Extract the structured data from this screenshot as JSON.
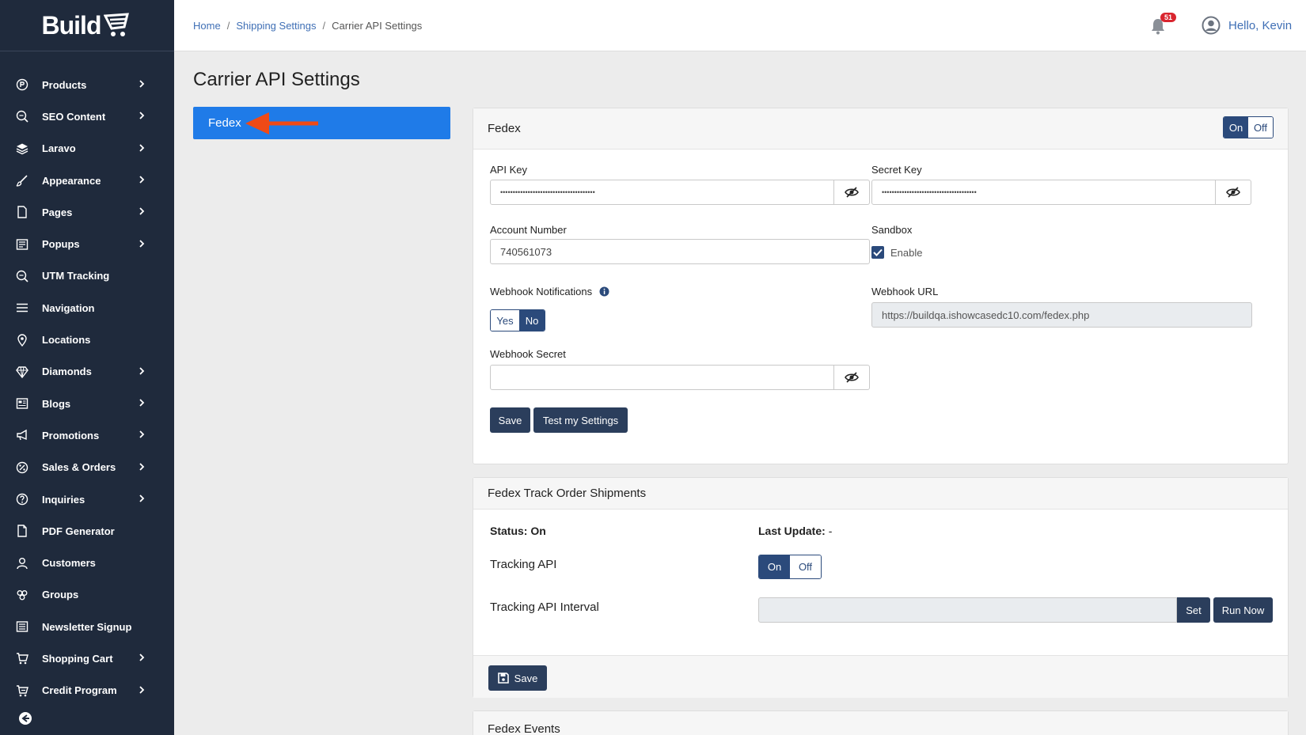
{
  "app": {
    "logo": "Build"
  },
  "sidebar": {
    "items": [
      {
        "label": "Products",
        "icon": "product-icon",
        "chevron": true
      },
      {
        "label": "SEO Content",
        "icon": "seo-icon",
        "chevron": true
      },
      {
        "label": "Laravo",
        "icon": "layers-icon",
        "chevron": true
      },
      {
        "label": "Appearance",
        "icon": "brush-icon",
        "chevron": true
      },
      {
        "label": "Pages",
        "icon": "page-icon",
        "chevron": true
      },
      {
        "label": "Popups",
        "icon": "popup-icon",
        "chevron": true
      },
      {
        "label": "UTM Tracking",
        "icon": "utm-icon",
        "chevron": false
      },
      {
        "label": "Navigation",
        "icon": "menu-icon",
        "chevron": false
      },
      {
        "label": "Locations",
        "icon": "location-pin-icon",
        "chevron": false
      },
      {
        "label": "Diamonds",
        "icon": "diamond-icon",
        "chevron": true
      },
      {
        "label": "Blogs",
        "icon": "blog-icon",
        "chevron": true
      },
      {
        "label": "Promotions",
        "icon": "megaphone-icon",
        "chevron": true
      },
      {
        "label": "Sales & Orders",
        "icon": "sales-icon",
        "chevron": true
      },
      {
        "label": "Inquiries",
        "icon": "question-icon",
        "chevron": true
      },
      {
        "label": "PDF Generator",
        "icon": "file-icon",
        "chevron": false
      },
      {
        "label": "Customers",
        "icon": "user-icon",
        "chevron": false
      },
      {
        "label": "Groups",
        "icon": "groups-icon",
        "chevron": false
      },
      {
        "label": "Newsletter Signup",
        "icon": "newsletter-icon",
        "chevron": false
      },
      {
        "label": "Shopping Cart",
        "icon": "cart-icon",
        "chevron": true
      },
      {
        "label": "Credit Program",
        "icon": "credit-cart-icon",
        "chevron": true
      }
    ]
  },
  "topbar": {
    "breadcrumb": [
      "Home",
      "Shipping Settings",
      "Carrier API Settings"
    ],
    "notification_count": "51",
    "greeting": "Hello, Kevin"
  },
  "page": {
    "title": "Carrier API Settings",
    "tab": "Fedex"
  },
  "fedex_card": {
    "title": "Fedex",
    "toggle_on": "On",
    "toggle_off": "Off",
    "api_key_label": "API Key",
    "api_key_value": "••••••••••••••••••••••••••••••••••••••",
    "secret_key_label": "Secret Key",
    "secret_key_value": "••••••••••••••••••••••••••••••••••••••",
    "account_number_label": "Account Number",
    "account_number_value": "740561073",
    "sandbox_label": "Sandbox",
    "sandbox_checkbox_label": "Enable",
    "webhook_notifications_label": "Webhook Notifications",
    "webhook_yes": "Yes",
    "webhook_no": "No",
    "webhook_url_label": "Webhook URL",
    "webhook_url_value": "https://buildqa.ishowcasedc10.com/fedex.php",
    "webhook_secret_label": "Webhook Secret",
    "webhook_secret_value": "",
    "save_label": "Save",
    "test_label": "Test my Settings"
  },
  "track_card": {
    "title": "Fedex Track Order Shipments",
    "status_label": "Status: On",
    "last_update_label": "Last Update:",
    "last_update_value": "-",
    "tracking_api_label": "Tracking API",
    "toggle_on": "On",
    "toggle_off": "Off",
    "interval_label": "Tracking API Interval",
    "interval_value": "",
    "set_label": "Set",
    "run_now_label": "Run Now",
    "save_label": "Save"
  },
  "events_card": {
    "title": "Fedex Events"
  },
  "colors": {
    "sidebar_bg": "#1f2a3c",
    "accent_blue": "#1f7be8",
    "dark_navy": "#2b4a7b",
    "arrow": "#ef4a16",
    "badge": "#d9252f"
  }
}
